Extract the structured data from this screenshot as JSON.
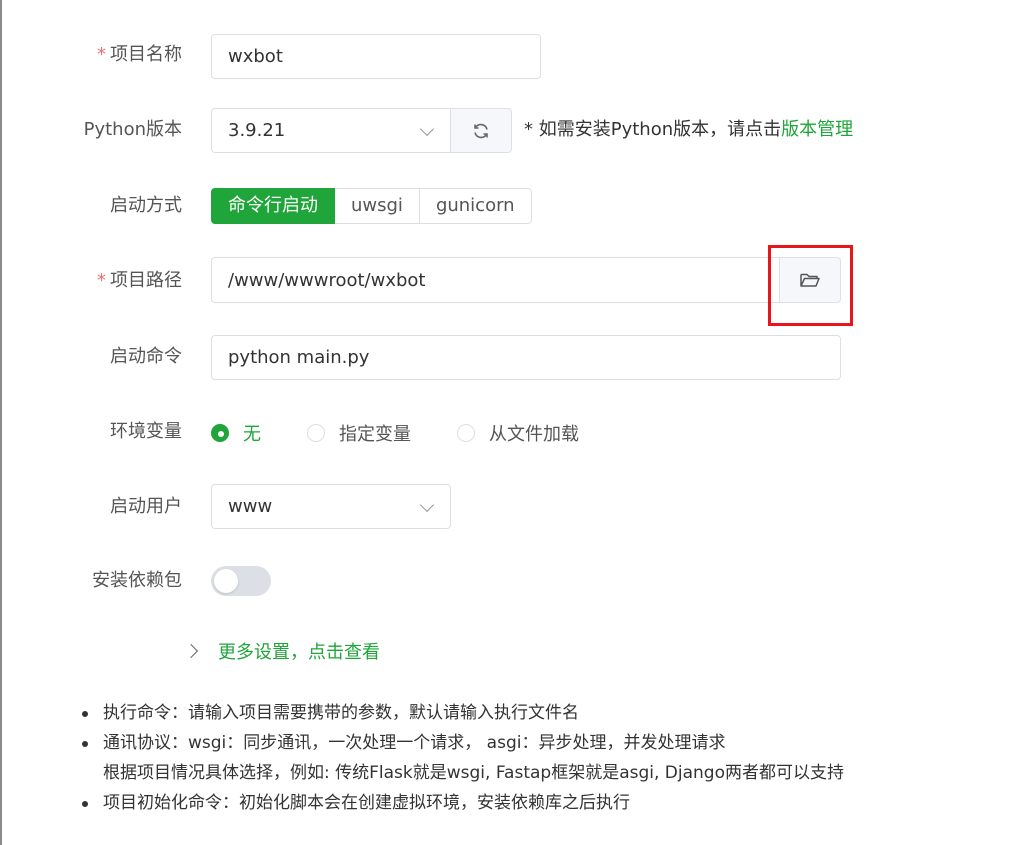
{
  "form": {
    "project_name": {
      "label": "项目名称",
      "value": "wxbot"
    },
    "python_version": {
      "label": "Python版本",
      "value": "3.9.21",
      "refresh_icon": "refresh-icon",
      "hint": "* 如需安装Python版本，请点击",
      "hint_link": "版本管理"
    },
    "start_mode": {
      "label": "启动方式",
      "options": [
        "命令行启动",
        "uwsgi",
        "gunicorn"
      ],
      "selected": "命令行启动"
    },
    "project_path": {
      "label": "项目路径",
      "value": "/www/wwwroot/wxbot",
      "folder_icon": "folder-open-icon"
    },
    "start_command": {
      "label": "启动命令",
      "value": "python main.py"
    },
    "env_vars": {
      "label": "环境变量",
      "options": [
        "无",
        "指定变量",
        "从文件加载"
      ],
      "selected": "无"
    },
    "start_user": {
      "label": "启动用户",
      "value": "www"
    },
    "install_deps": {
      "label": "安装依赖包",
      "enabled": false
    },
    "more_settings": "更多设置，点击查看"
  },
  "notes": [
    "执行命令：请输入项目需要携带的参数，默认请输入执行文件名",
    "通讯协议：wsgi：同步通讯，一次处理一个请求， asgi：异步处理，并发处理请求",
    "根据项目情况具体选择，例如: 传统Flask就是wsgi, Fastap框架就是asgi, Django两者都可以支持",
    "项目初始化命令：初始化脚本会在创建虚拟环境，安装依赖库之后执行"
  ],
  "colors": {
    "accent": "#20a53a",
    "required": "#f56c6c",
    "highlight_box": "#e8161c"
  }
}
